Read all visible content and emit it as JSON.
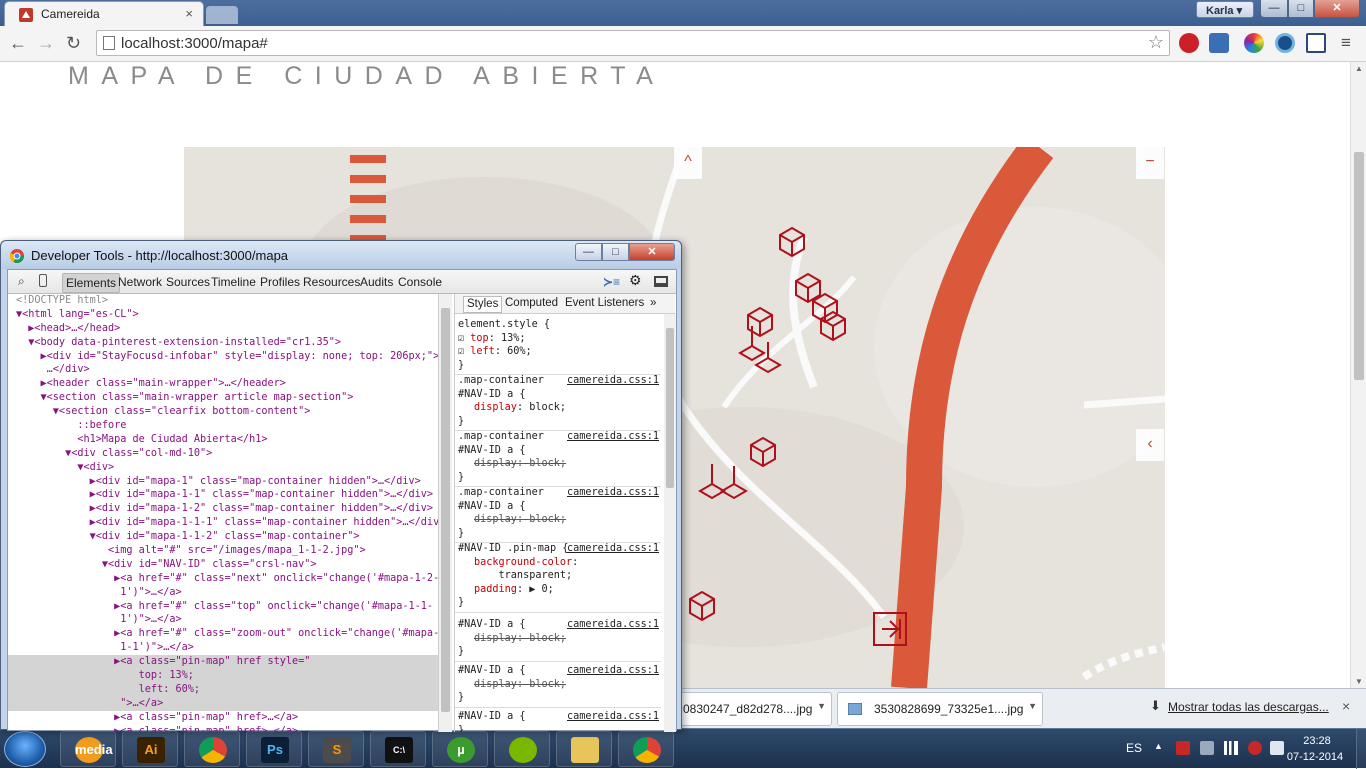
{
  "browser": {
    "tab_title": "Camereida",
    "tab_close": "×",
    "profile_name": "Karla ▾",
    "url": "localhost:3000/mapa#",
    "window_min": "—",
    "window_max": "□",
    "window_close": "✕"
  },
  "page": {
    "title": "MAPA DE CIUDAD ABIERTA",
    "map_controls": {
      "top": "^",
      "zoom_out": "−",
      "prev": "‹"
    }
  },
  "downloads": {
    "items": [
      {
        "name": "0830247_d82d278....jpg"
      },
      {
        "name": "3530828699_73325e1....jpg"
      }
    ],
    "show_all": "Mostrar todas las descargas...",
    "close": "×"
  },
  "devtools": {
    "title": "Developer Tools - http://localhost:3000/mapa",
    "tabs": [
      "Elements",
      "Network",
      "Sources",
      "Timeline",
      "Profiles",
      "Resources",
      "Audits",
      "Console"
    ],
    "style_tabs": [
      "Styles",
      "Computed",
      "Event Listeners",
      "»"
    ],
    "dom_lines": [
      "<!DOCTYPE html>",
      "▼<html lang=\"es-CL\">",
      "  ▶<head>…</head>",
      "  ▼<body data-pinterest-extension-installed=\"cr1.35\">",
      "    ▶<div id=\"StayFocusd-infobar\" style=\"display: none; top: 206px;\">",
      "     …</div>",
      "    ▶<header class=\"main-wrapper\">…</header>",
      "    ▼<section class=\"main-wrapper article map-section\">",
      "      ▼<section class=\"clearfix bottom-content\">",
      "          ::before",
      "          <h1>Mapa de Ciudad Abierta</h1>",
      "        ▼<div class=\"col-md-10\">",
      "          ▼<div>",
      "            ▶<div id=\"mapa-1\" class=\"map-container hidden\">…</div>",
      "            ▶<div id=\"mapa-1-1\" class=\"map-container hidden\">…</div>",
      "            ▶<div id=\"mapa-1-2\" class=\"map-container hidden\">…</div>",
      "            ▶<div id=\"mapa-1-1-1\" class=\"map-container hidden\">…</div>",
      "            ▼<div id=\"mapa-1-1-2\" class=\"map-container\">",
      "               <img alt=\"#\" src=\"/images/mapa_1-1-2.jpg\">",
      "              ▼<div id=\"NAV-ID\" class=\"crsl-nav\">",
      "                ▶<a href=\"#\" class=\"next\" onclick=\"change('#mapa-1-2-",
      "                 1')\">…</a>",
      "                ▶<a href=\"#\" class=\"top\" onclick=\"change('#mapa-1-1-",
      "                 1')\">…</a>",
      "                ▶<a href=\"#\" class=\"zoom-out\" onclick=\"change('#mapa-",
      "                 1-1')\">…</a>",
      "                ▶<a class=\"pin-map\" href style=\"",
      "                    top: 13%;",
      "                    left: 60%;",
      "                 \">…</a>",
      "                ▶<a class=\"pin-map\" href>…</a>",
      "                ▶<a class=\"pin-map\" href>…</a>"
    ],
    "style_rules": [
      {
        "selector": "element.style {",
        "source": "",
        "props": [
          [
            "top",
            "13%;",
            false
          ],
          [
            "left",
            "60%;",
            false
          ]
        ]
      },
      {
        "selector": ".map-container\n#NAV-ID a {",
        "source": "camereida.css:1",
        "props": [
          [
            "display",
            "block;",
            false
          ]
        ]
      },
      {
        "selector": ".map-container\n#NAV-ID a {",
        "source": "camereida.css:1",
        "props": [
          [
            "display",
            "block;",
            true
          ]
        ]
      },
      {
        "selector": ".map-container\n#NAV-ID a {",
        "source": "camereida.css:1",
        "props": [
          [
            "display",
            "block;",
            true
          ]
        ]
      },
      {
        "selector": "#NAV-ID .pin-map {",
        "source": "camereida.css:1",
        "props": [
          [
            "background-color",
            "\n    transparent;",
            false
          ],
          [
            "padding",
            "▶ 0;",
            false
          ]
        ]
      },
      {
        "selector": "#NAV-ID a {",
        "source": "camereida.css:1",
        "props": [
          [
            "display",
            "block;",
            true
          ]
        ]
      },
      {
        "selector": "#NAV-ID a {",
        "source": "camereida.css:1",
        "props": [
          [
            "display",
            "block;",
            true
          ]
        ]
      },
      {
        "selector": "#NAV-ID a {",
        "source": "camereida.css:1",
        "props": []
      }
    ]
  },
  "taskbar": {
    "apps": [
      "media",
      "Ai",
      "chrome",
      "Ps",
      "S",
      "C:\\",
      "µ",
      "spotify",
      "explorer",
      "chrome"
    ],
    "language": "ES",
    "time": "23:28",
    "date": "07-12-2014"
  },
  "colors": {
    "accent": "#c0392b",
    "road": "#d9593a",
    "pin": "#b0101c"
  }
}
